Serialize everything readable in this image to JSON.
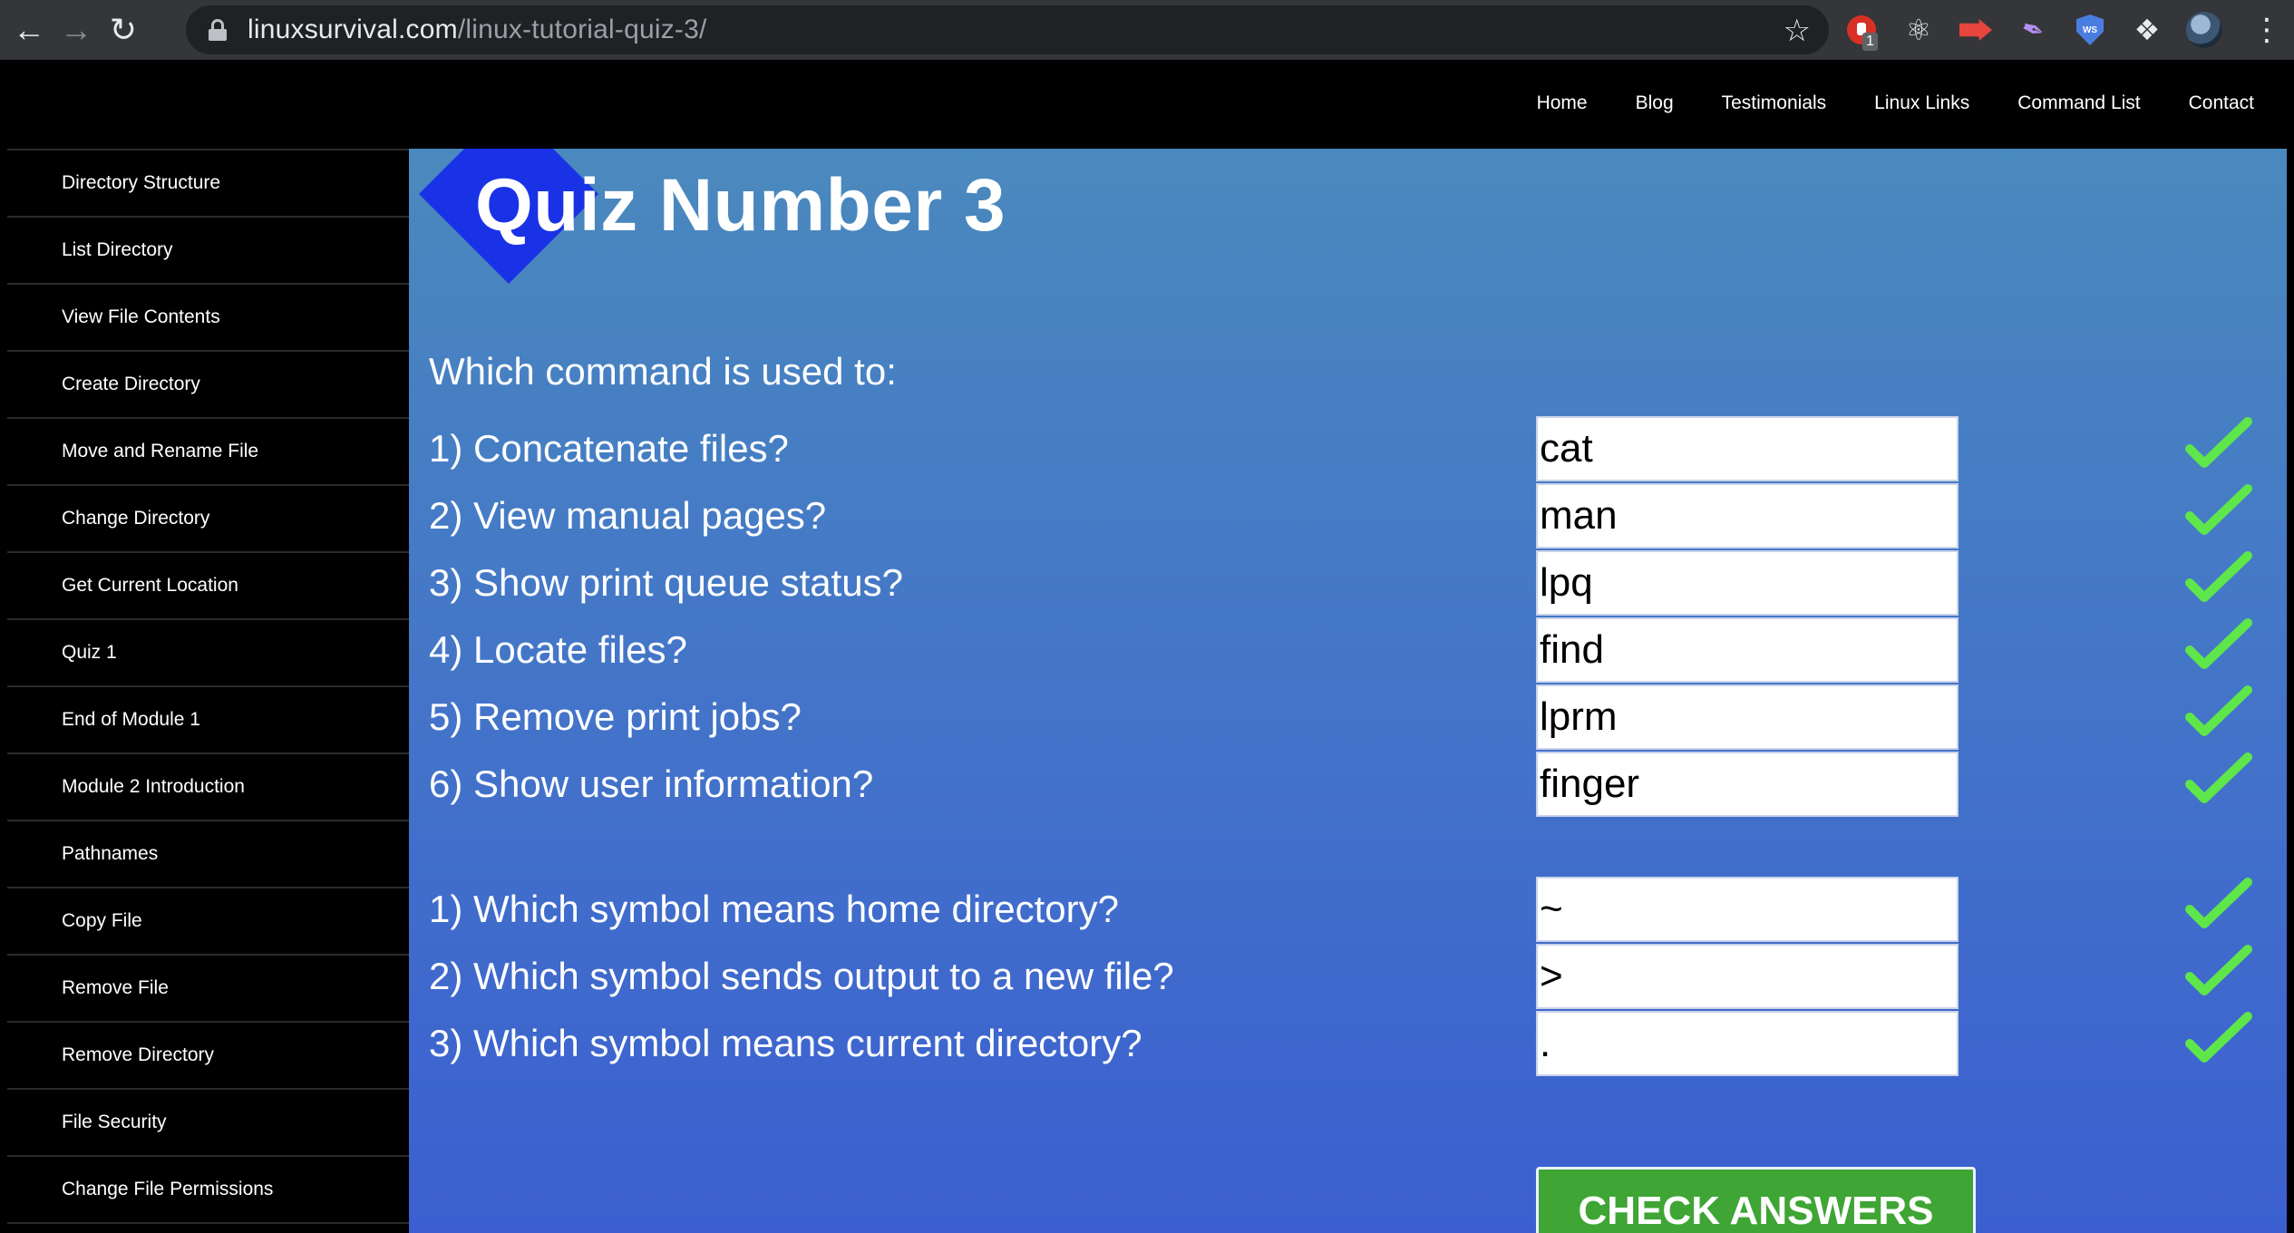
{
  "browser": {
    "url_host": "linuxsurvival.com",
    "url_path": "/linux-tutorial-quiz-3/",
    "extension_badge": "1",
    "shield_label": "WS"
  },
  "topnav": [
    "Home",
    "Blog",
    "Testimonials",
    "Linux Links",
    "Command List",
    "Contact"
  ],
  "sidebar": [
    "Directory Structure",
    "List Directory",
    "View File Contents",
    "Create Directory",
    "Move and Rename File",
    "Change Directory",
    "Get Current Location",
    "Quiz 1",
    "End of Module 1",
    "Module 2 Introduction",
    "Pathnames",
    "Copy File",
    "Remove File",
    "Remove Directory",
    "File Security",
    "Change File Permissions"
  ],
  "quiz": {
    "title": "Quiz Number 3",
    "prompt": "Which command is used to:",
    "commands": [
      {
        "question": "1) Concatenate files?",
        "answer": "cat",
        "correct": true
      },
      {
        "question": "2) View manual pages?",
        "answer": "man",
        "correct": true
      },
      {
        "question": "3) Show print queue status?",
        "answer": "lpq",
        "correct": true
      },
      {
        "question": "4) Locate files?",
        "answer": "find",
        "correct": true
      },
      {
        "question": "5) Remove print jobs?",
        "answer": "lprm",
        "correct": true
      },
      {
        "question": "6) Show user information?",
        "answer": "finger",
        "correct": true
      }
    ],
    "symbols": [
      {
        "question": "1) Which symbol means home directory?",
        "answer": "~",
        "correct": true
      },
      {
        "question": "2) Which symbol sends output to a new file?",
        "answer": ">",
        "correct": true
      },
      {
        "question": "3) Which symbol means current directory?",
        "answer": ".",
        "correct": true
      }
    ],
    "submit_label": "CHECK ANSWERS"
  },
  "colors": {
    "check_mark": "#5ee64a",
    "submit_button": "#3fa535",
    "title_diamond": "#1a32e6"
  }
}
